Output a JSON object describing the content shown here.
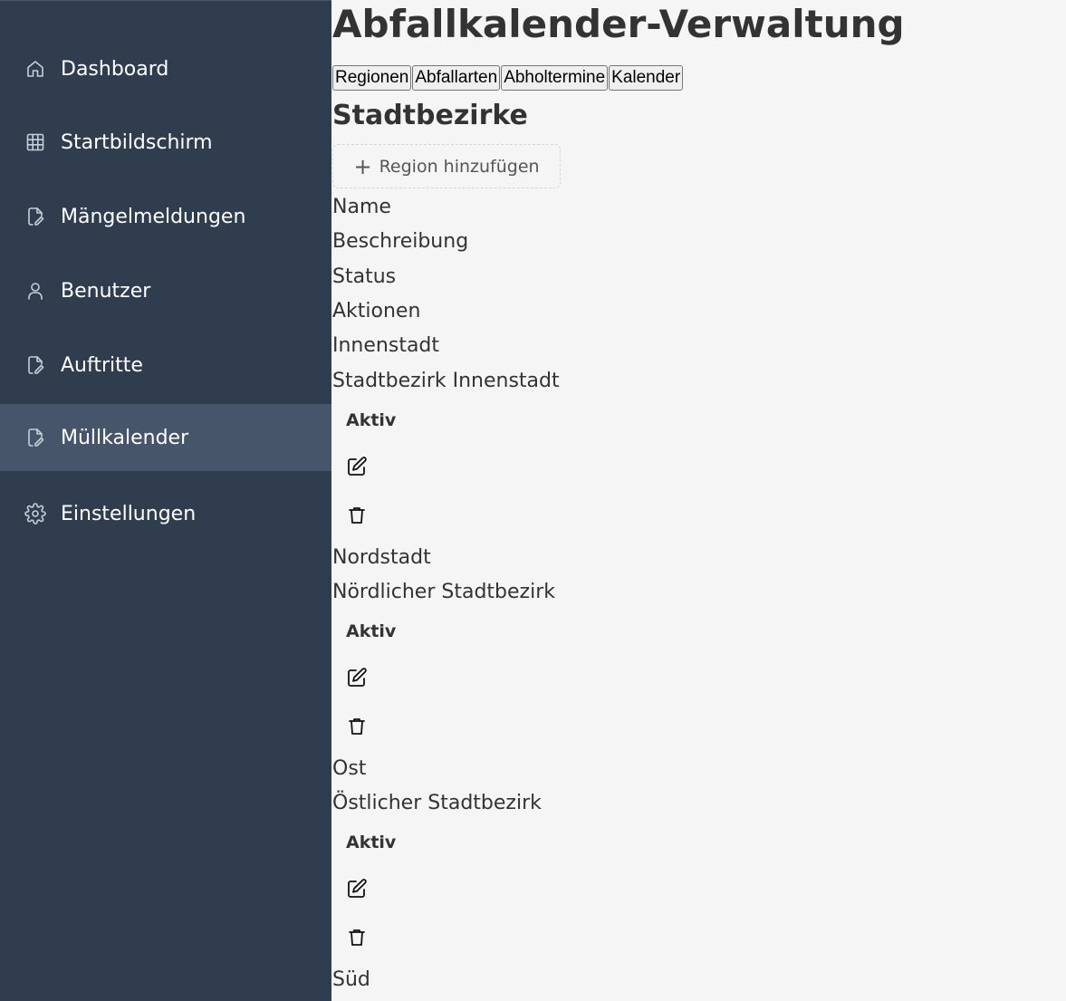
{
  "sidebar": {
    "items": [
      {
        "label": "Dashboard",
        "icon": "home-icon"
      },
      {
        "label": "Startbildschirm",
        "icon": "grid-icon"
      },
      {
        "label": "Mängelmeldungen",
        "icon": "file-edit-icon"
      },
      {
        "label": "Benutzer",
        "icon": "user-icon"
      },
      {
        "label": "Auftritte",
        "icon": "file-edit-icon"
      },
      {
        "label": "Müllkalender",
        "icon": "file-edit-icon",
        "active": true
      },
      {
        "label": "Einstellungen",
        "icon": "gear-icon"
      }
    ]
  },
  "main": {
    "title": "Abfallkalender-Verwaltung",
    "tabs": [
      "Regionen",
      "Abfallarten",
      "Abholtermine",
      "Kalender"
    ],
    "section_title": "Stadtbezirke",
    "add_button_label": "Region hinzufügen",
    "table": {
      "headers": [
        "Name",
        "Beschreibung",
        "Status",
        "Aktionen"
      ],
      "rows": [
        {
          "name": "Innenstadt",
          "description": "Stadtbezirk Innenstadt",
          "status": "Aktiv"
        },
        {
          "name": "Nordstadt",
          "description": "Nördlicher Stadtbezirk",
          "status": "Aktiv"
        },
        {
          "name": "Ost",
          "description": "Östlicher Stadtbezirk",
          "status": "Aktiv"
        },
        {
          "name": "Süd"
        }
      ]
    }
  },
  "colors": {
    "sidebar_bg": "#2f3d4f",
    "sidebar_active_bg": "#47556a",
    "main_bg": "#f5f5f5",
    "text": "#333333"
  }
}
